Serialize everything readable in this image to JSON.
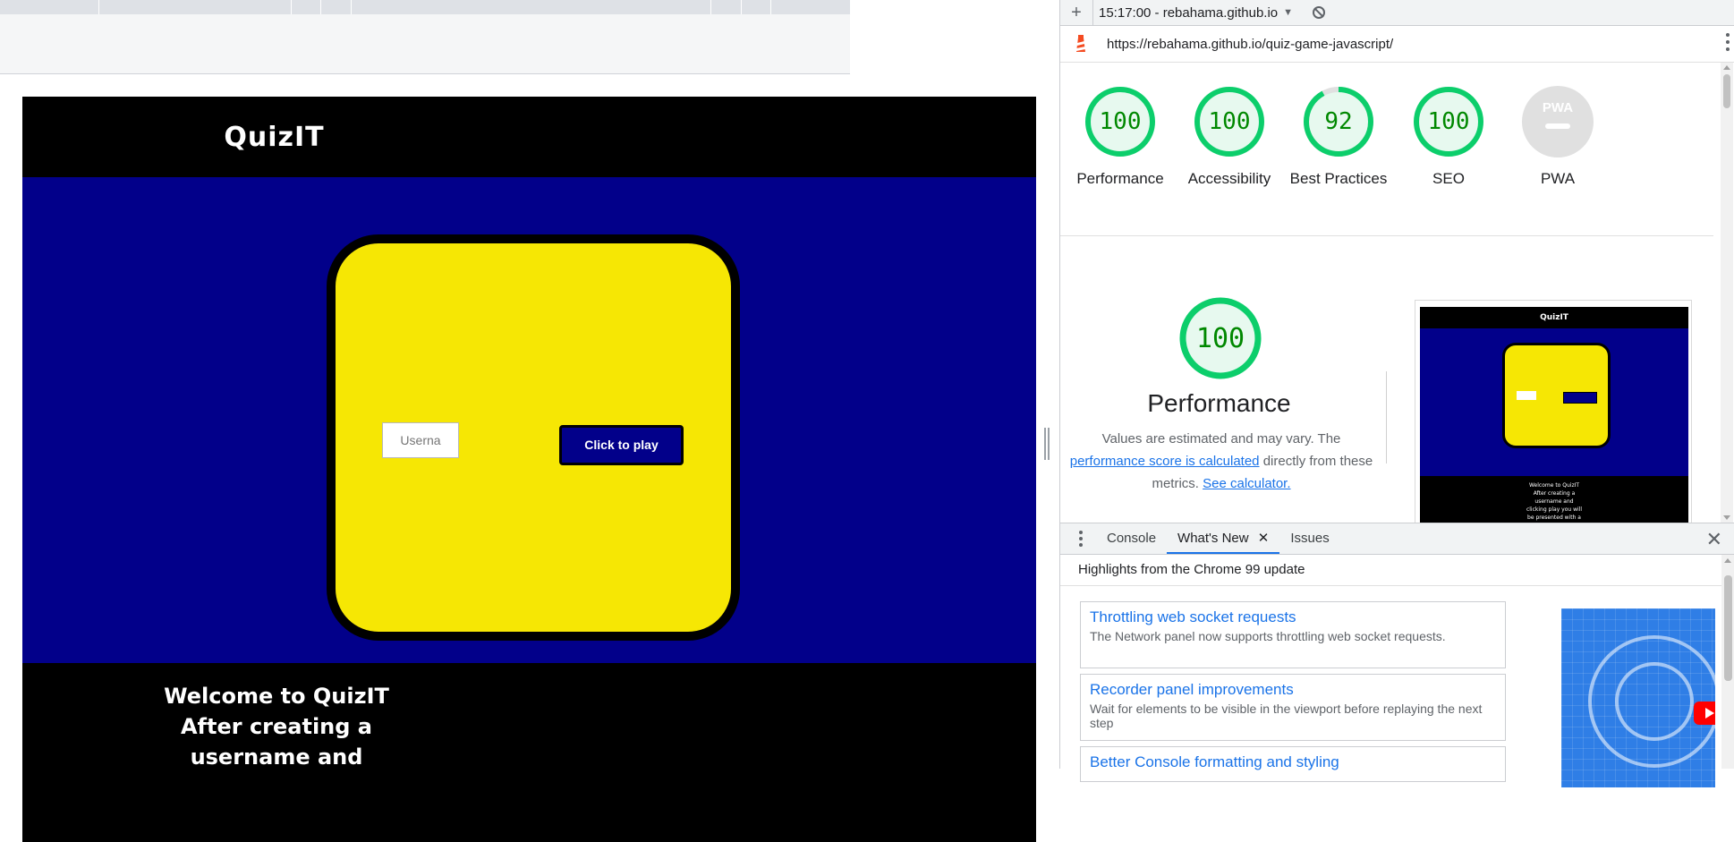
{
  "site": {
    "title": "QuizIT",
    "username_placeholder": "Userna",
    "play_button": "Click to play",
    "welcome_lines": [
      "Welcome to QuizIT",
      "After creating a",
      "username and"
    ]
  },
  "devtools": {
    "report_select": "15:17:00 - rebahama.github.io",
    "url": "https://rebahama.github.io/quiz-game-javascript/",
    "gauges": [
      {
        "score": "100",
        "label": "Performance",
        "type": "pass"
      },
      {
        "score": "100",
        "label": "Accessibility",
        "type": "pass"
      },
      {
        "score": "92",
        "label": "Best Practices",
        "type": "pass",
        "fraction": 0.92
      },
      {
        "score": "100",
        "label": "SEO",
        "type": "pass"
      },
      {
        "score": "PWA",
        "label": "PWA",
        "type": "pwa"
      }
    ],
    "perf_score": "100",
    "perf_title": "Performance",
    "perf_desc_prefix": "Values are estimated and may vary. The",
    "perf_desc_link": "performance score is calculated",
    "perf_desc_middle": "directly from these metrics.",
    "perf_desc_calc": "See calculator.",
    "thumb": {
      "title": "QuizIT",
      "footer_lines": [
        "Welcome to QuizIT",
        "After creating a",
        "username and",
        "clicking play you will",
        "be presented with a"
      ]
    },
    "drawer_tabs": [
      "Console",
      "What's New",
      "Issues"
    ],
    "highlights": "Highlights from the Chrome 99 update",
    "news": [
      {
        "title": "Throttling web socket requests",
        "desc": "The Network panel now supports throttling web socket requests."
      },
      {
        "title": "Recorder panel improvements",
        "desc": "Wait for elements to be visible in the viewport before replaying the next step"
      },
      {
        "title": "Better Console formatting and styling",
        "desc": ""
      }
    ],
    "colors": {
      "pass": "#0cce6b",
      "pass_text": "#008800",
      "pass_bg": "#e7f9ef",
      "link": "#1a73e8",
      "site_blue": "#02008a",
      "site_yellow": "#f6e704"
    },
    "icons": [
      "plus-icon",
      "caret-down-icon",
      "block-icon",
      "lighthouse-icon",
      "kebab-menu-icon",
      "close-icon",
      "play-icon"
    ]
  }
}
